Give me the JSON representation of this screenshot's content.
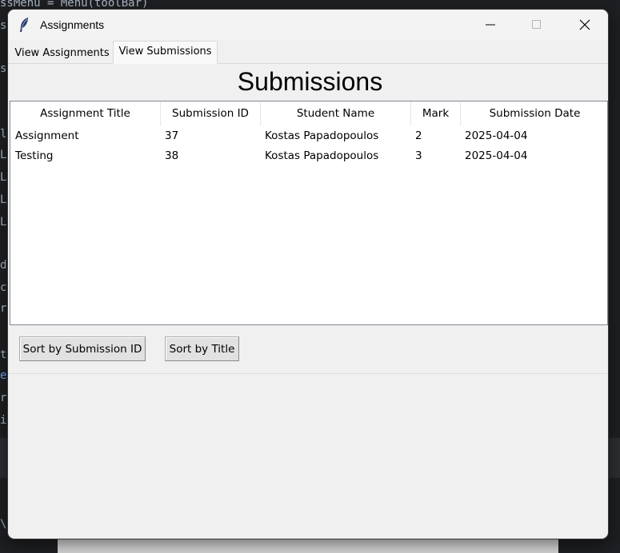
{
  "background": {
    "code_lines": [
      "ssMenu = Menu(toolBar)",
      "ss",
      "ss",
      "ld",
      "LB",
      "LB",
      "LB",
      "LB",
      "d",
      "c(",
      "r.",
      "t",
      "e0",
      "r.",
      "in",
      "\\"
    ]
  },
  "window": {
    "title": "Assignments",
    "app_icon": "feather-icon",
    "controls": [
      "minimize-icon",
      "maximize-icon",
      "close-icon"
    ]
  },
  "tabs": [
    {
      "label": "View Assignments",
      "selected": false
    },
    {
      "label": "View Submissions",
      "selected": true
    }
  ],
  "page": {
    "title": "Submissions"
  },
  "table": {
    "columns": [
      "Assignment Title",
      "Submission ID",
      "Student Name",
      "Mark",
      "Submission Date"
    ],
    "rows": [
      [
        "Assignment",
        "37",
        "Kostas Papadopoulos",
        "2",
        "2025-04-04"
      ],
      [
        "Testing",
        "38",
        "Kostas Papadopoulos",
        "3",
        "2025-04-04"
      ]
    ]
  },
  "buttons": {
    "sort_by_id": "Sort by Submission ID",
    "sort_by_title": "Sort by Title"
  }
}
